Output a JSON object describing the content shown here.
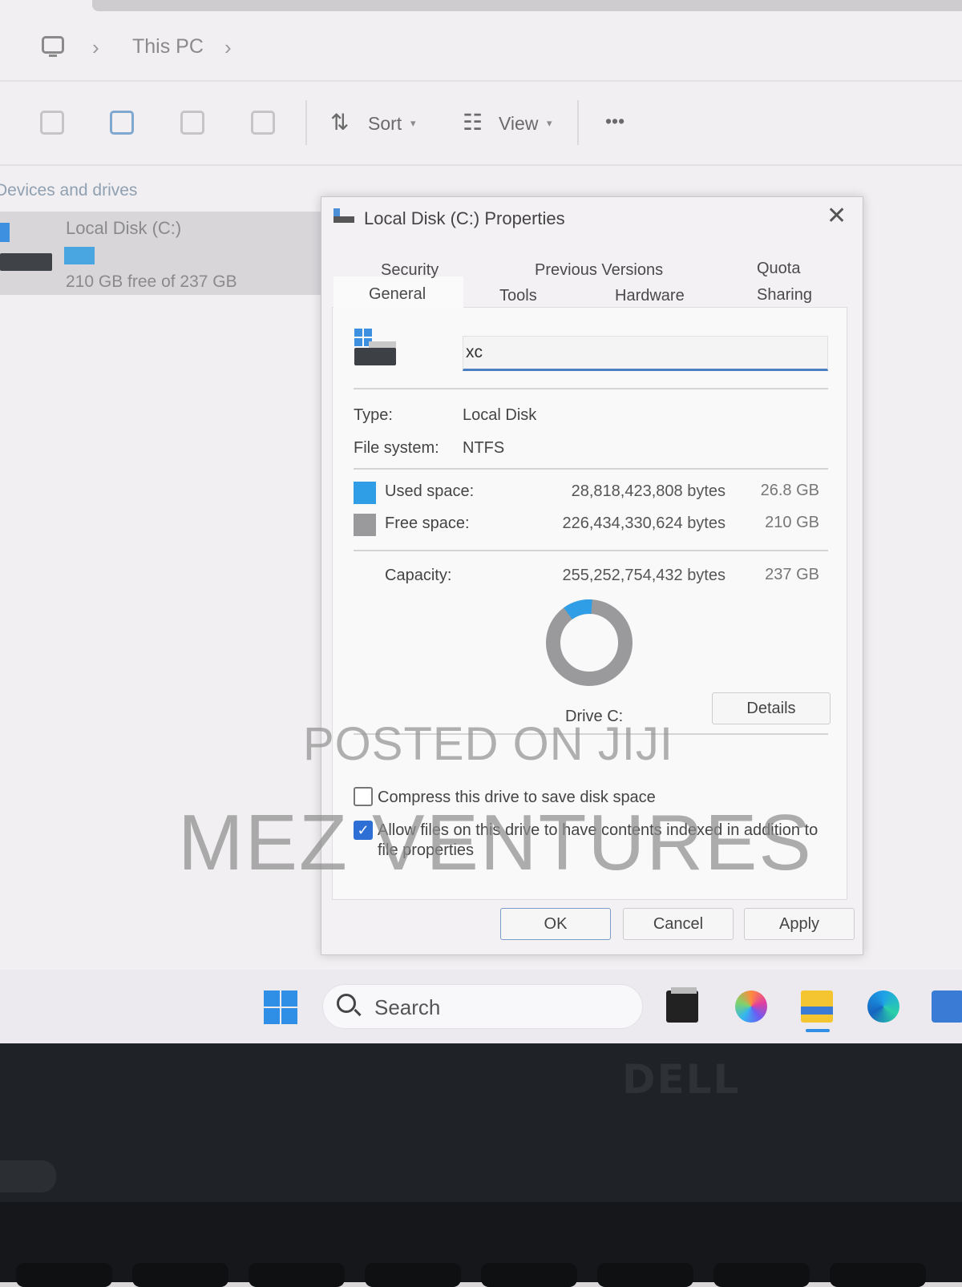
{
  "explorer": {
    "breadcrumb": [
      "This PC"
    ],
    "toolbar": {
      "sort_label": "Sort",
      "view_label": "View",
      "more_label": "•••"
    },
    "group_title": "Devices and drives",
    "drive": {
      "name": "Local Disk (C:)",
      "free_text": "210 GB free of 237 GB",
      "used_fraction": 0.113
    }
  },
  "dialog": {
    "title": "Local Disk (C:) Properties",
    "close_glyph": "✕",
    "tabs_row1": [
      "Security",
      "Previous Versions",
      "Quota"
    ],
    "tabs_row2": [
      "General",
      "Tools",
      "Hardware",
      "Sharing"
    ],
    "active_tab": "General",
    "drive_name_value": "xc",
    "type_label": "Type:",
    "type_value": "Local Disk",
    "fs_label": "File system:",
    "fs_value": "NTFS",
    "used": {
      "label": "Used space:",
      "bytes": "28,818,423,808 bytes",
      "gb": "26.8 GB",
      "color": "#2f9ee6"
    },
    "free": {
      "label": "Free space:",
      "bytes": "226,434,330,624 bytes",
      "gb": "210 GB",
      "color": "#9a999b"
    },
    "capacity": {
      "label": "Capacity:",
      "bytes": "255,252,754,432 bytes",
      "gb": "237 GB"
    },
    "drive_label": "Drive C:",
    "details_button": "Details",
    "compress_label": "Compress this drive to save disk space",
    "compress_checked": false,
    "index_label_line1": "Allow files on this drive to have contents indexed in addition to",
    "index_label_line2": "file properties",
    "index_checked": true,
    "buttons": {
      "ok": "OK",
      "cancel": "Cancel",
      "apply": "Apply"
    }
  },
  "taskbar": {
    "search_placeholder": "Search"
  },
  "laptop": {
    "brand": "DELL"
  },
  "watermark": {
    "line1": "POSTED ON JIJI",
    "line2": "MEZ VENTURES"
  }
}
